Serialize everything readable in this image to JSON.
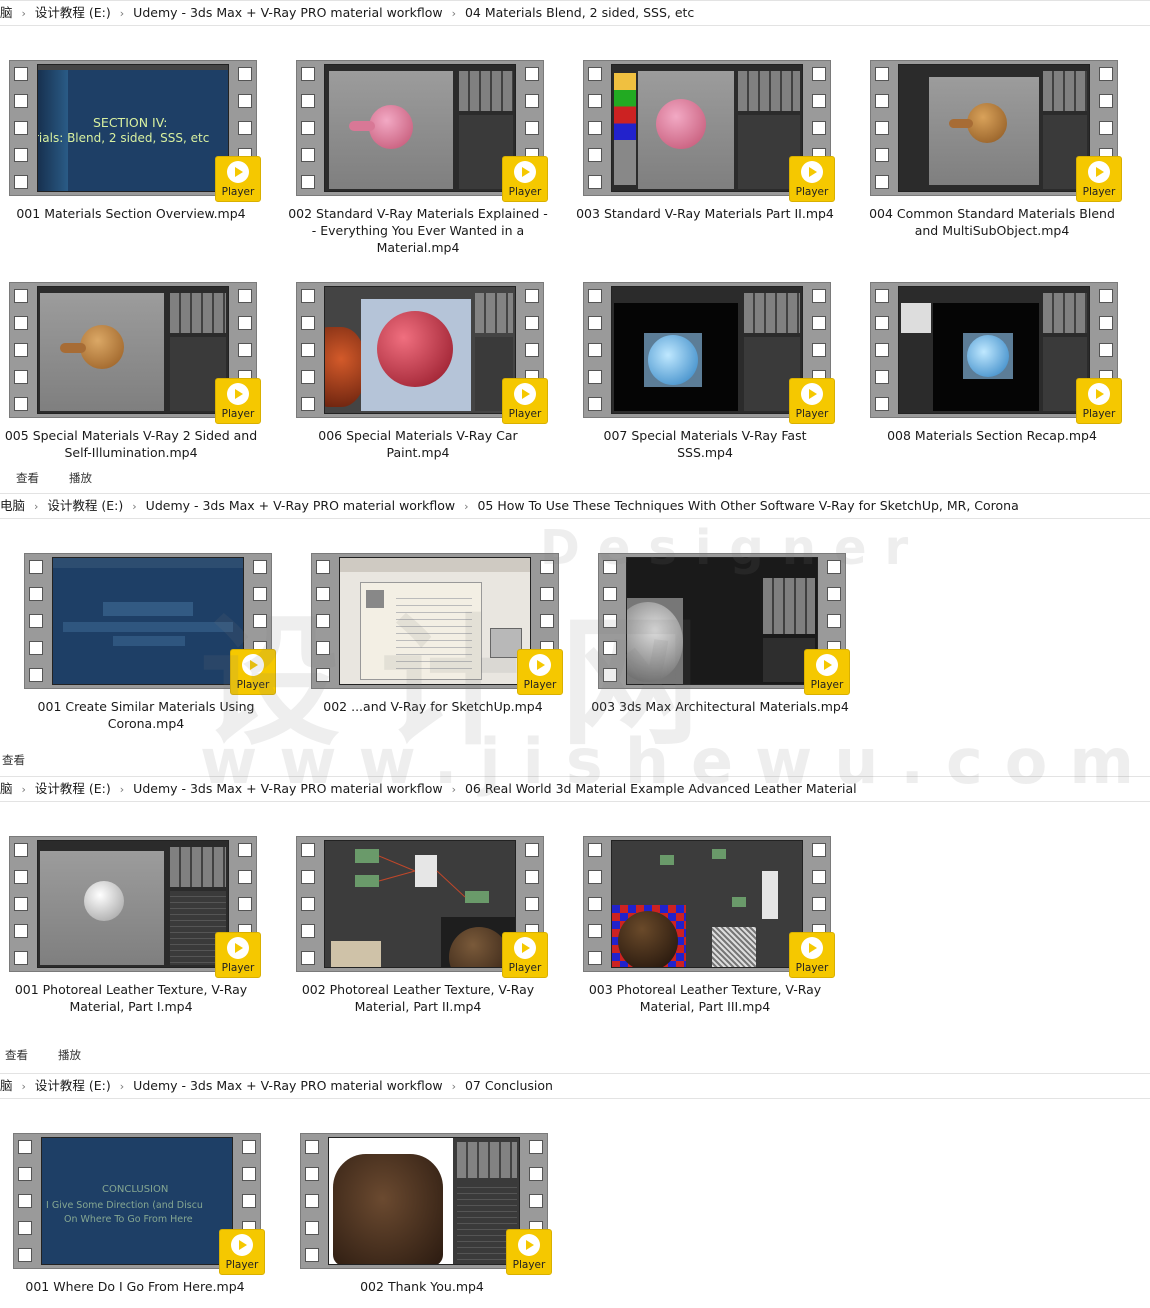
{
  "player_label": "Player",
  "sections": [
    {
      "breadcrumb": [
        "脑",
        "设计教程 (E:)",
        "Udemy - 3ds Max + V-Ray PRO material workflow",
        "04 Materials Blend, 2 sided, SSS, etc"
      ],
      "files": [
        {
          "name": "001 Materials Section Overview.mp4",
          "slide_title": "SECTION IV:",
          "slide_sub": "rials: Blend, 2 sided, SSS, etc"
        },
        {
          "name": "002 Standard V-Ray Materials Explained -- Everything You Ever Wanted in a Material.mp4"
        },
        {
          "name": "003 Standard V-Ray Materials Part II.mp4"
        },
        {
          "name": "004 Common Standard Materials Blend and MultiSubObject.mp4"
        },
        {
          "name": "005 Special Materials V-Ray 2 Sided and Self-Illumination.mp4"
        },
        {
          "name": "006 Special Materials V-Ray Car Paint.mp4"
        },
        {
          "name": "007 Special Materials V-Ray Fast SSS.mp4"
        },
        {
          "name": "008 Materials Section Recap.mp4"
        }
      ],
      "toolbar": [
        "查看",
        "播放"
      ]
    },
    {
      "breadcrumb": [
        "电脑",
        "设计教程 (E:)",
        "Udemy - 3ds Max + V-Ray PRO material workflow",
        "05 How To Use These Techniques With Other Software V-Ray for SketchUp, MR, Corona"
      ],
      "files": [
        {
          "name": "001 Create Similar Materials Using Corona.mp4"
        },
        {
          "name": "002 ...and V-Ray for SketchUp.mp4"
        },
        {
          "name": "003 3ds Max Architectural Materials.mp4"
        }
      ],
      "toolbar": [
        "查看"
      ]
    },
    {
      "breadcrumb": [
        "脑",
        "设计教程 (E:)",
        "Udemy - 3ds Max + V-Ray PRO material workflow",
        "06 Real World 3d Material Example Advanced Leather Material"
      ],
      "files": [
        {
          "name": "001 Photoreal Leather Texture, V-Ray Material, Part I.mp4"
        },
        {
          "name": "002 Photoreal Leather Texture, V-Ray Material, Part II.mp4"
        },
        {
          "name": "003 Photoreal Leather Texture, V-Ray Material, Part III.mp4"
        }
      ],
      "toolbar": [
        "查看",
        "播放"
      ]
    },
    {
      "breadcrumb": [
        "脑",
        "设计教程 (E:)",
        "Udemy - 3ds Max + V-Ray PRO material workflow",
        "07 Conclusion"
      ],
      "files": [
        {
          "name": "001 Where Do I Go From Here.mp4",
          "slide_title": "CONCLUSION",
          "slide_sub": "I Give Some Direction (and Discu",
          "slide_sub2": "On Where To Go From Here"
        },
        {
          "name": "002 Thank You.mp4"
        }
      ]
    }
  ],
  "watermark": {
    "top": "Designer",
    "main": "设计网",
    "bottom": "www.jishewu.com"
  },
  "colors": {
    "player": "#f5c800",
    "film": "#9a9a9a",
    "slide_blue": "#1e3f66"
  }
}
